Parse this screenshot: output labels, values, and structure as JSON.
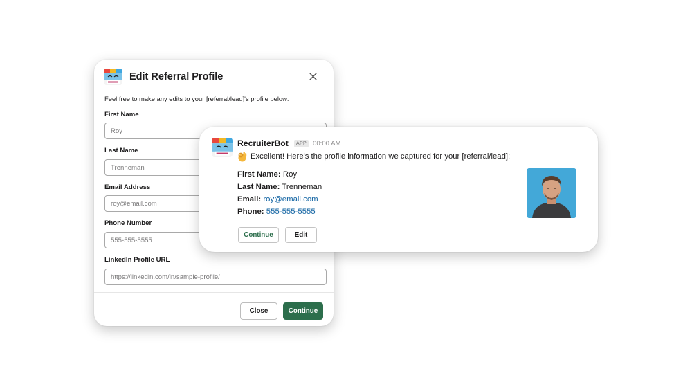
{
  "modal": {
    "title": "Edit Referral Profile",
    "intro": "Feel free to make any edits to your [referral/lead]'s profile below:",
    "fields": [
      {
        "label": "First Name",
        "placeholder": "Roy"
      },
      {
        "label": "Last Name",
        "placeholder": "Trenneman"
      },
      {
        "label": "Email Address",
        "placeholder": "roy@email.com"
      },
      {
        "label": "Phone Number",
        "placeholder": "555-555-5555"
      },
      {
        "label": "LinkedIn Profile URL",
        "placeholder": "https://linkedin.com/in/sample-profile/"
      }
    ],
    "close_label": "Close",
    "continue_label": "Continue"
  },
  "message": {
    "bot_name": "RecruiterBot",
    "badge": "APP",
    "time": "00:00 AM",
    "text": "Excellent! Here's the profile information we captured for your [referral/lead]:",
    "first_name_label": "First Name:",
    "first_name": "Roy",
    "last_name_label": "Last Name:",
    "last_name": "Trenneman",
    "email_label": "Email:",
    "email": "roy@email.com",
    "phone_label": "Phone:",
    "phone": "555-555-5555",
    "continue_label": "Continue",
    "edit_label": "Edit"
  },
  "colors": {
    "primary_button": "#2c6e4c",
    "link": "#1264a3",
    "photo_background": "#43a8d8"
  },
  "icons": [
    "app-logo-icon",
    "close-icon",
    "ok-hand-icon"
  ]
}
